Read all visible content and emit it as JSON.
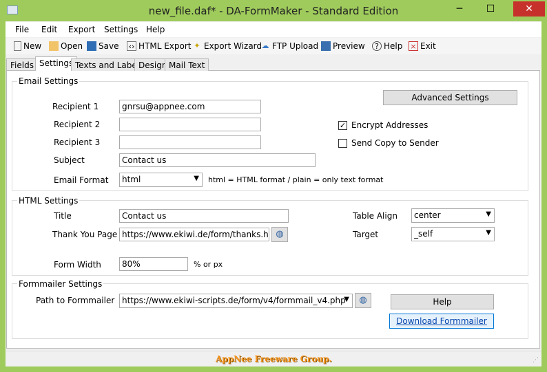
{
  "window": {
    "title": "new_file.daf* - DA-FormMaker  - Standard Edition",
    "minimize": "─",
    "maximize": "☐",
    "close": "✕"
  },
  "menu": [
    "File",
    "Edit",
    "Export",
    "Settings",
    "Help"
  ],
  "toolbar": [
    {
      "label": "New",
      "icon": "new-file-icon"
    },
    {
      "label": "Open",
      "icon": "open-folder-icon"
    },
    {
      "label": "Save",
      "icon": "save-icon"
    },
    {
      "label": "HTML Export",
      "icon": "html-export-icon"
    },
    {
      "label": "Export Wizard",
      "icon": "wizard-wand-icon"
    },
    {
      "label": "FTP Upload",
      "icon": "cloud-upload-icon"
    },
    {
      "label": "Preview",
      "icon": "monitor-icon"
    },
    {
      "label": "Help",
      "icon": "help-icon"
    },
    {
      "label": "Exit",
      "icon": "exit-icon"
    }
  ],
  "tabs": [
    "Fields",
    "Settings",
    "Texts and Labels",
    "Design",
    "Mail Text"
  ],
  "email": {
    "group": "Email Settings",
    "recipient1_label": "Recipient 1",
    "recipient1": "gnrsu@appnee.com",
    "recipient2_label": "Recipient 2",
    "recipient2": "",
    "recipient3_label": "Recipient 3",
    "recipient3": "",
    "subject_label": "Subject",
    "subject": "Contact us",
    "format_label": "Email Format",
    "format": "html",
    "format_hint": "html = HTML format / plain = only text format",
    "advanced": "Advanced Settings",
    "encrypt_label": "Encrypt Addresses",
    "encrypt": true,
    "copy_label": "Send Copy to Sender",
    "copy": false
  },
  "html": {
    "group": "HTML Settings",
    "title_label": "Title",
    "title": "Contact us",
    "thanks_label": "Thank You Page",
    "thanks": "https://www.ekiwi.de/form/thanks.htm",
    "width_label": "Form Width",
    "width": "80%",
    "width_hint": "% or px",
    "align_label": "Table Align",
    "align": "center",
    "target_label": "Target",
    "target": "_self"
  },
  "formmailer": {
    "group": "Formmailer Settings",
    "path_label": "Path to Formmailer",
    "path": "https://www.ekiwi-scripts.de/form/v4/formmail_v4.php",
    "help": "Help",
    "download": "Download Formmailer"
  },
  "status": {
    "brand": "AppNee Freeware Group."
  }
}
